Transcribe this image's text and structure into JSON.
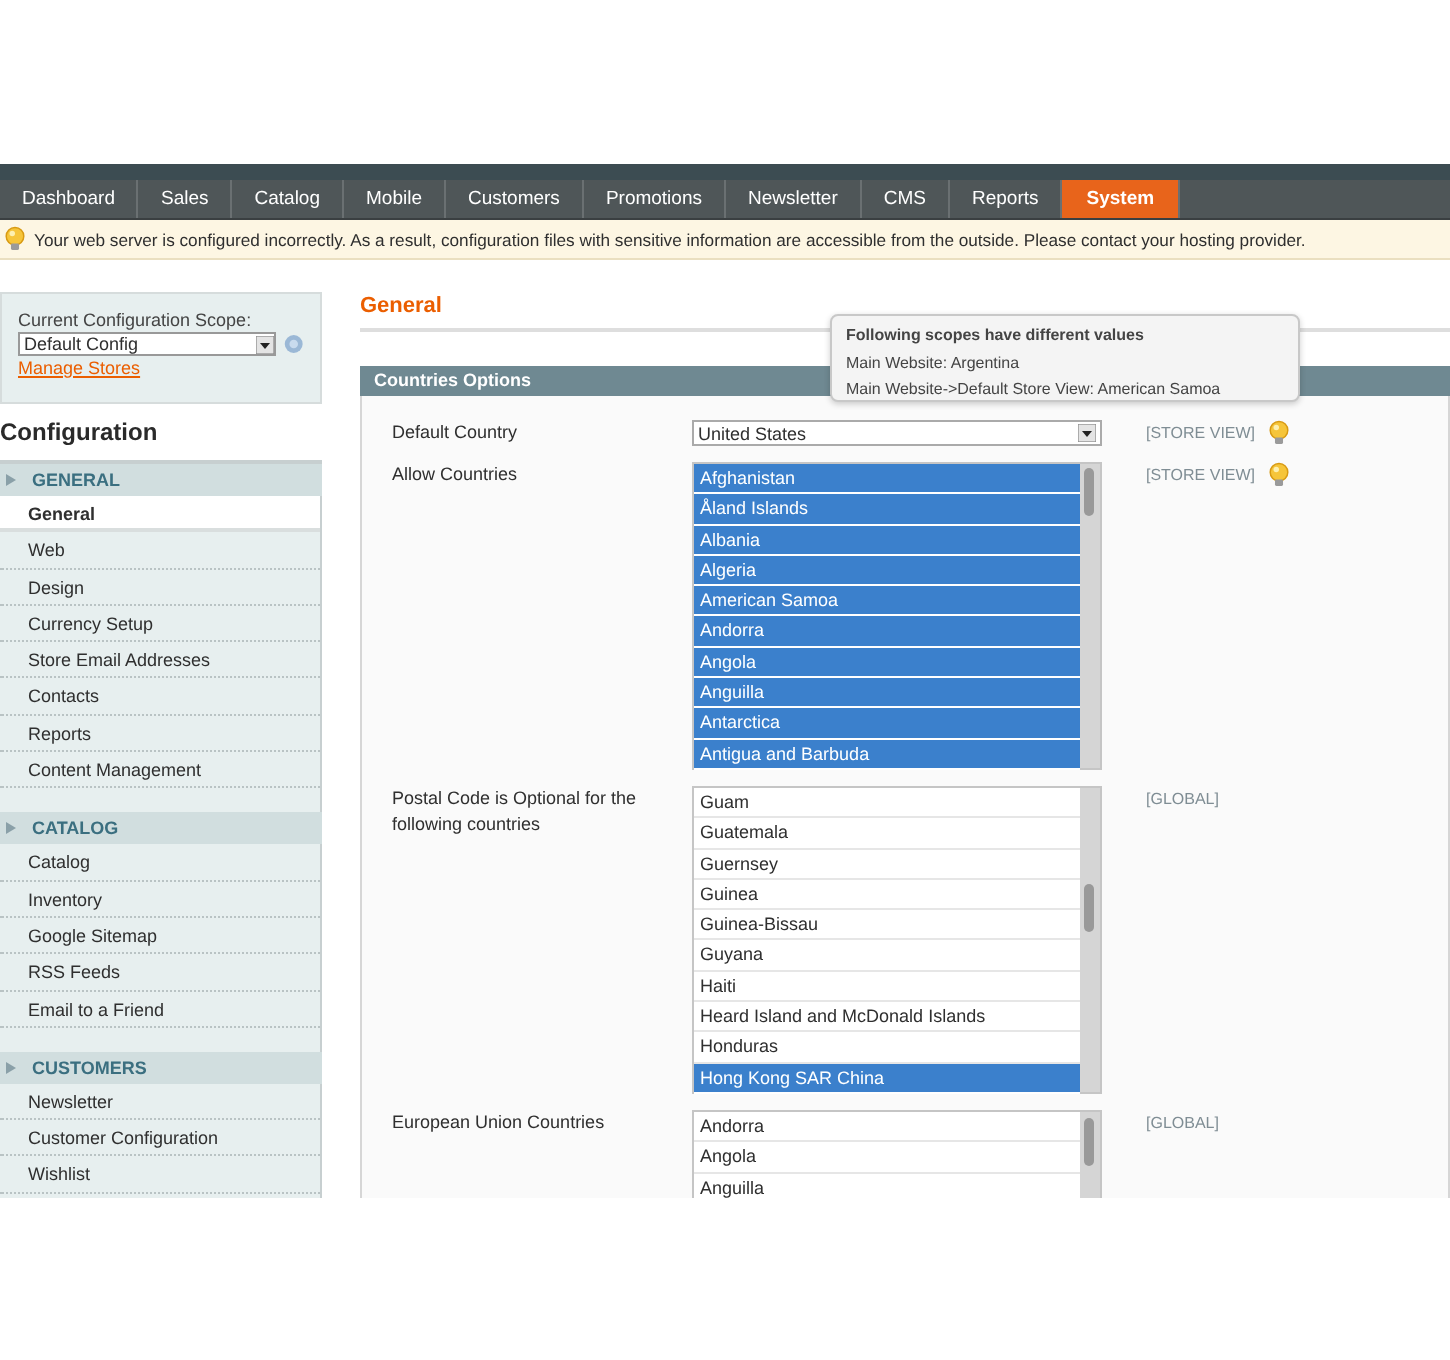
{
  "nav_tabs": [
    {
      "label": "Dashboard",
      "selected": false
    },
    {
      "label": "Sales",
      "selected": false
    },
    {
      "label": "Catalog",
      "selected": false
    },
    {
      "label": "Mobile",
      "selected": false
    },
    {
      "label": "Customers",
      "selected": false
    },
    {
      "label": "Promotions",
      "selected": false
    },
    {
      "label": "Newsletter",
      "selected": false
    },
    {
      "label": "CMS",
      "selected": false
    },
    {
      "label": "Reports",
      "selected": false
    },
    {
      "label": "System",
      "selected": true
    }
  ],
  "notice": {
    "text": "Your web server is configured incorrectly. As a result, configuration files with sensitive information are accessible from the outside. Please contact your hosting provider."
  },
  "scope": {
    "label": "Current Configuration Scope:",
    "value": "Default Config",
    "link": "Manage Stores"
  },
  "sidebar": {
    "title": "Configuration",
    "sections": [
      {
        "title": "GENERAL",
        "items": [
          {
            "label": "General",
            "selected": true
          },
          {
            "label": "Web",
            "selected": false
          },
          {
            "label": "Design",
            "selected": false
          },
          {
            "label": "Currency Setup",
            "selected": false
          },
          {
            "label": "Store Email Addresses",
            "selected": false
          },
          {
            "label": "Contacts",
            "selected": false
          },
          {
            "label": "Reports",
            "selected": false
          },
          {
            "label": "Content Management",
            "selected": false
          }
        ]
      },
      {
        "title": "CATALOG",
        "items": [
          {
            "label": "Catalog",
            "selected": false
          },
          {
            "label": "Inventory",
            "selected": false
          },
          {
            "label": "Google Sitemap",
            "selected": false
          },
          {
            "label": "RSS Feeds",
            "selected": false
          },
          {
            "label": "Email to a Friend",
            "selected": false
          }
        ]
      },
      {
        "title": "CUSTOMERS",
        "items": [
          {
            "label": "Newsletter",
            "selected": false
          },
          {
            "label": "Customer Configuration",
            "selected": false
          },
          {
            "label": "Wishlist",
            "selected": false
          }
        ]
      }
    ]
  },
  "page_title": "General",
  "section": {
    "title": "Countries Options",
    "fields": [
      {
        "kind": "select",
        "label": "Default Country",
        "value": "United States",
        "scope": "[STORE VIEW]",
        "hint": true
      },
      {
        "kind": "multiselect",
        "label": "Allow Countries",
        "scope": "[STORE VIEW]",
        "hint": true,
        "options": [
          {
            "label": "Afghanistan",
            "selected": true
          },
          {
            "label": "Åland Islands",
            "selected": true
          },
          {
            "label": "Albania",
            "selected": true
          },
          {
            "label": "Algeria",
            "selected": true
          },
          {
            "label": "American Samoa",
            "selected": true
          },
          {
            "label": "Andorra",
            "selected": true
          },
          {
            "label": "Angola",
            "selected": true
          },
          {
            "label": "Anguilla",
            "selected": true
          },
          {
            "label": "Antarctica",
            "selected": true
          },
          {
            "label": "Antigua and Barbuda",
            "selected": true
          }
        ]
      },
      {
        "kind": "multiselect",
        "label": "Postal Code is Optional for the following countries",
        "scope": "[GLOBAL]",
        "hint": false,
        "options": [
          {
            "label": "Guam",
            "selected": false
          },
          {
            "label": "Guatemala",
            "selected": false
          },
          {
            "label": "Guernsey",
            "selected": false
          },
          {
            "label": "Guinea",
            "selected": false
          },
          {
            "label": "Guinea-Bissau",
            "selected": false
          },
          {
            "label": "Guyana",
            "selected": false
          },
          {
            "label": "Haiti",
            "selected": false
          },
          {
            "label": "Heard Island and McDonald Islands",
            "selected": false
          },
          {
            "label": "Honduras",
            "selected": false
          },
          {
            "label": "Hong Kong SAR China",
            "selected": true
          }
        ]
      },
      {
        "kind": "multiselect",
        "label": "European Union Countries",
        "scope": "[GLOBAL]",
        "hint": false,
        "options": [
          {
            "label": "Andorra",
            "selected": false
          },
          {
            "label": "Angola",
            "selected": false
          },
          {
            "label": "Anguilla",
            "selected": false
          }
        ]
      }
    ]
  },
  "tooltip": {
    "title": "Following scopes have different values",
    "lines": [
      "Main Website: Argentina",
      "Main Website->Default Store View: American Samoa"
    ]
  }
}
